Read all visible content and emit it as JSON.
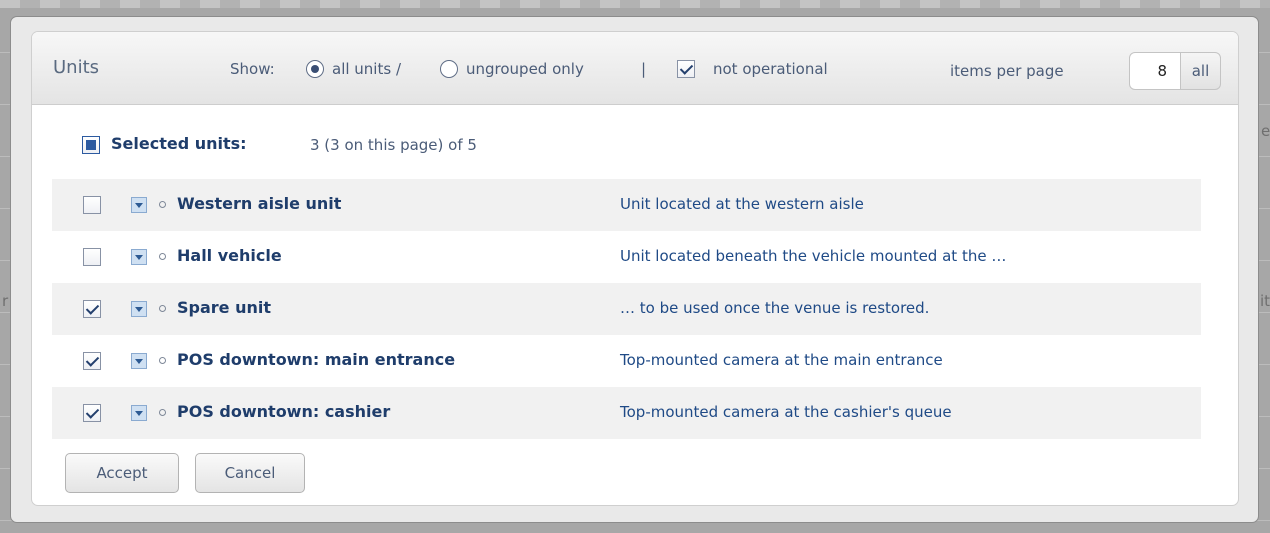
{
  "dialog": {
    "title": "Units",
    "show_label": "Show:",
    "filter_options": [
      {
        "label": "all units /",
        "checked": true
      },
      {
        "label": "ungrouped only",
        "checked": false
      }
    ],
    "separator": "|",
    "not_operational": {
      "label": "not operational",
      "checked": true
    },
    "items_per_page": {
      "label": "items per page",
      "value": "8",
      "all_label": "all"
    }
  },
  "selection": {
    "label": "Selected units",
    "colon": ":",
    "summary": "3 (3 on this page) of 5",
    "state": "partial"
  },
  "units": [
    {
      "name": "Western aisle unit",
      "description": "Unit located at the western aisle",
      "checked": false
    },
    {
      "name": "Hall vehicle",
      "description": "Unit located beneath the vehicle mounted at the …",
      "checked": false
    },
    {
      "name": "Spare unit",
      "description": "… to be used once the venue is restored.",
      "checked": true
    },
    {
      "name": "POS downtown: main entrance",
      "description": "Top-mounted camera at the main entrance",
      "checked": true
    },
    {
      "name": "POS downtown: cashier",
      "description": "Top-mounted camera at the cashier's queue",
      "checked": true
    }
  ],
  "buttons": {
    "accept": "Accept",
    "cancel": "Cancel"
  },
  "background": {
    "edge_left": "r",
    "edge_right_top": "e",
    "edge_right_mid": "it"
  },
  "colors": {
    "accent": "#1f3d6b",
    "link": "#1f4a86",
    "muted_text": "#4b5c78"
  }
}
